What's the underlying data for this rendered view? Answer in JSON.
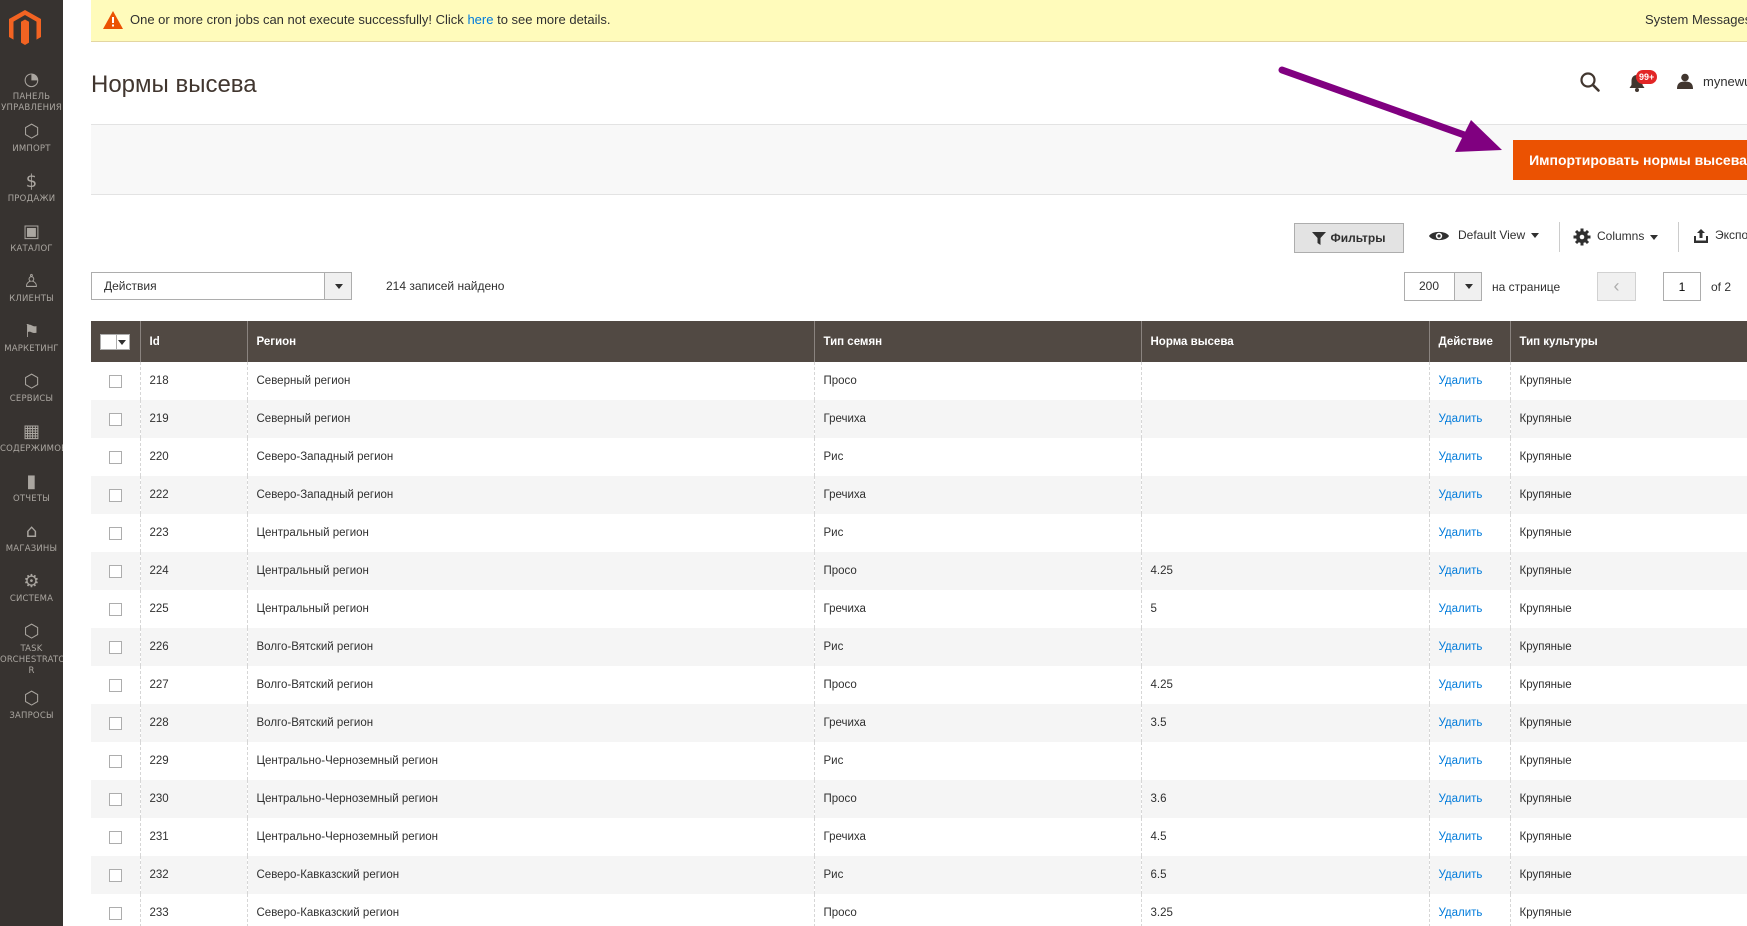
{
  "sidebar": {
    "items": [
      {
        "label": "ПАНЕЛЬ\nУПРАВЛЕНИЯ",
        "icon": "dashboard-icon"
      },
      {
        "label": "ИМПОРТ",
        "icon": "hexagon-icon"
      },
      {
        "label": "ПРОДАЖИ",
        "icon": "dollar-icon"
      },
      {
        "label": "КАТАЛОГ",
        "icon": "cube-icon"
      },
      {
        "label": "КЛИЕНТЫ",
        "icon": "person-icon"
      },
      {
        "label": "МАРКЕТИНГ",
        "icon": "megaphone-icon"
      },
      {
        "label": "СЕРВИСЫ",
        "icon": "hexagon-icon"
      },
      {
        "label": "СОДЕРЖИМОЕ",
        "icon": "layout-icon"
      },
      {
        "label": "ОТЧЁТЫ",
        "icon": "bar-chart-icon"
      },
      {
        "label": "МАГАЗИНЫ",
        "icon": "store-icon"
      },
      {
        "label": "СИСТЕМА",
        "icon": "gear-icon"
      },
      {
        "label": "TASK\nORCHESTRATO\nR",
        "icon": "hexagon-icon"
      },
      {
        "label": "ЗАПРОСЫ",
        "icon": "hexagon-icon"
      }
    ]
  },
  "message": {
    "text_before": "One or more cron jobs can not execute successfully! Click ",
    "link": "here",
    "text_after": " to see more details.",
    "right": "System Messages"
  },
  "header": {
    "title": "Нормы высева",
    "badge": "99+",
    "username": "mynewu"
  },
  "import_button": "Импортировать нормы высева",
  "toolbar": {
    "filters": "Фильтры",
    "view": "Default View",
    "columns": "Columns",
    "export": "Экспорт"
  },
  "listing": {
    "actions": "Действия",
    "records": "214 записей найдено",
    "per_page": "200",
    "per_page_label": "на странице",
    "page": "1",
    "of": "of 2"
  },
  "table": {
    "headers": [
      "Id",
      "Регион",
      "Тип семян",
      "Норма высева",
      "Действие",
      "Тип культуры"
    ],
    "rows": [
      {
        "id": "218",
        "region": "Северный регион",
        "seed": "Просо",
        "rate": "",
        "action": "Удалить",
        "crop": "Крупяные"
      },
      {
        "id": "219",
        "region": "Северный регион",
        "seed": "Гречиха",
        "rate": "",
        "action": "Удалить",
        "crop": "Крупяные"
      },
      {
        "id": "220",
        "region": "Северо-Западный регион",
        "seed": "Рис",
        "rate": "",
        "action": "Удалить",
        "crop": "Крупяные"
      },
      {
        "id": "222",
        "region": "Северо-Западный регион",
        "seed": "Гречиха",
        "rate": "",
        "action": "Удалить",
        "crop": "Крупяные"
      },
      {
        "id": "223",
        "region": "Центральный регион",
        "seed": "Рис",
        "rate": "",
        "action": "Удалить",
        "crop": "Крупяные"
      },
      {
        "id": "224",
        "region": "Центральный регион",
        "seed": "Просо",
        "rate": "4.25",
        "action": "Удалить",
        "crop": "Крупяные"
      },
      {
        "id": "225",
        "region": "Центральный регион",
        "seed": "Гречиха",
        "rate": "5",
        "action": "Удалить",
        "crop": "Крупяные"
      },
      {
        "id": "226",
        "region": "Волго-Вятский регион",
        "seed": "Рис",
        "rate": "",
        "action": "Удалить",
        "crop": "Крупяные"
      },
      {
        "id": "227",
        "region": "Волго-Вятский регион",
        "seed": "Просо",
        "rate": "4.25",
        "action": "Удалить",
        "crop": "Крупяные"
      },
      {
        "id": "228",
        "region": "Волго-Вятский регион",
        "seed": "Гречиха",
        "rate": "3.5",
        "action": "Удалить",
        "crop": "Крупяные"
      },
      {
        "id": "229",
        "region": "Центрально-Черноземный регион",
        "seed": "Рис",
        "rate": "",
        "action": "Удалить",
        "crop": "Крупяные"
      },
      {
        "id": "230",
        "region": "Центрально-Черноземный регион",
        "seed": "Просо",
        "rate": "3.6",
        "action": "Удалить",
        "crop": "Крупяные"
      },
      {
        "id": "231",
        "region": "Центрально-Черноземный регион",
        "seed": "Гречиха",
        "rate": "4.5",
        "action": "Удалить",
        "crop": "Крупяные"
      },
      {
        "id": "232",
        "region": "Северо-Кавказский регион",
        "seed": "Рис",
        "rate": "6.5",
        "action": "Удалить",
        "crop": "Крупяные"
      },
      {
        "id": "233",
        "region": "Северо-Кавказский регион",
        "seed": "Просо",
        "rate": "3.25",
        "action": "Удалить",
        "crop": "Крупяные"
      }
    ]
  },
  "colors": {
    "sidebar_bg": "#373330",
    "accent": "#eb5202",
    "header_bg": "#514943",
    "link": "#007bdb",
    "arrow": "#800080"
  }
}
